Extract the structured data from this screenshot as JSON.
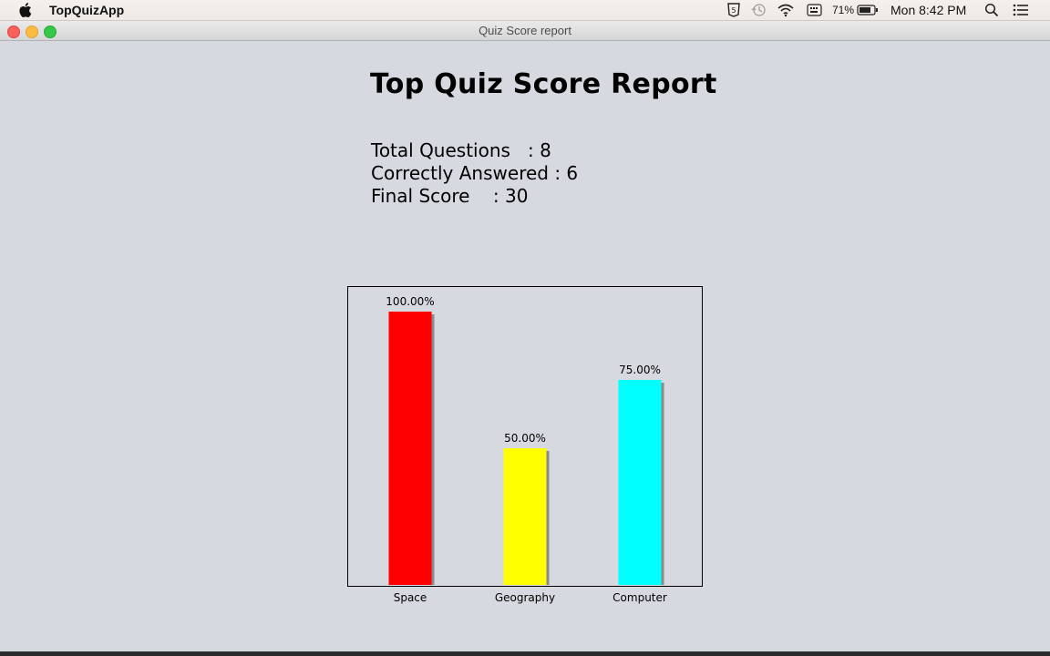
{
  "menubar": {
    "app_name": "TopQuizApp",
    "battery_percent": "71%",
    "clock": "Mon 8:42 PM",
    "icons": [
      "apple-icon",
      "html5-icon",
      "time-machine-icon",
      "wifi-icon",
      "keyboard-icon",
      "battery-icon",
      "spotlight-icon",
      "notification-center-icon"
    ]
  },
  "window": {
    "title": "Quiz Score report"
  },
  "report": {
    "title": "Top Quiz Score Report",
    "total_questions": "Total Questions   : 8",
    "correctly_answered": "Correctly Answered : 6",
    "final_score": "Final Score    : 30"
  },
  "chart_data": {
    "type": "bar",
    "categories": [
      "Space",
      "Geography",
      "Computer"
    ],
    "values": [
      100,
      50,
      75
    ],
    "value_labels": [
      "100.00%",
      "50.00%",
      "75.00%"
    ],
    "colors": [
      "#ff0000",
      "#ffff00",
      "#00ffff"
    ],
    "ylim": [
      0,
      100
    ],
    "title": "",
    "xlabel": "",
    "ylabel": "",
    "grid": false
  }
}
